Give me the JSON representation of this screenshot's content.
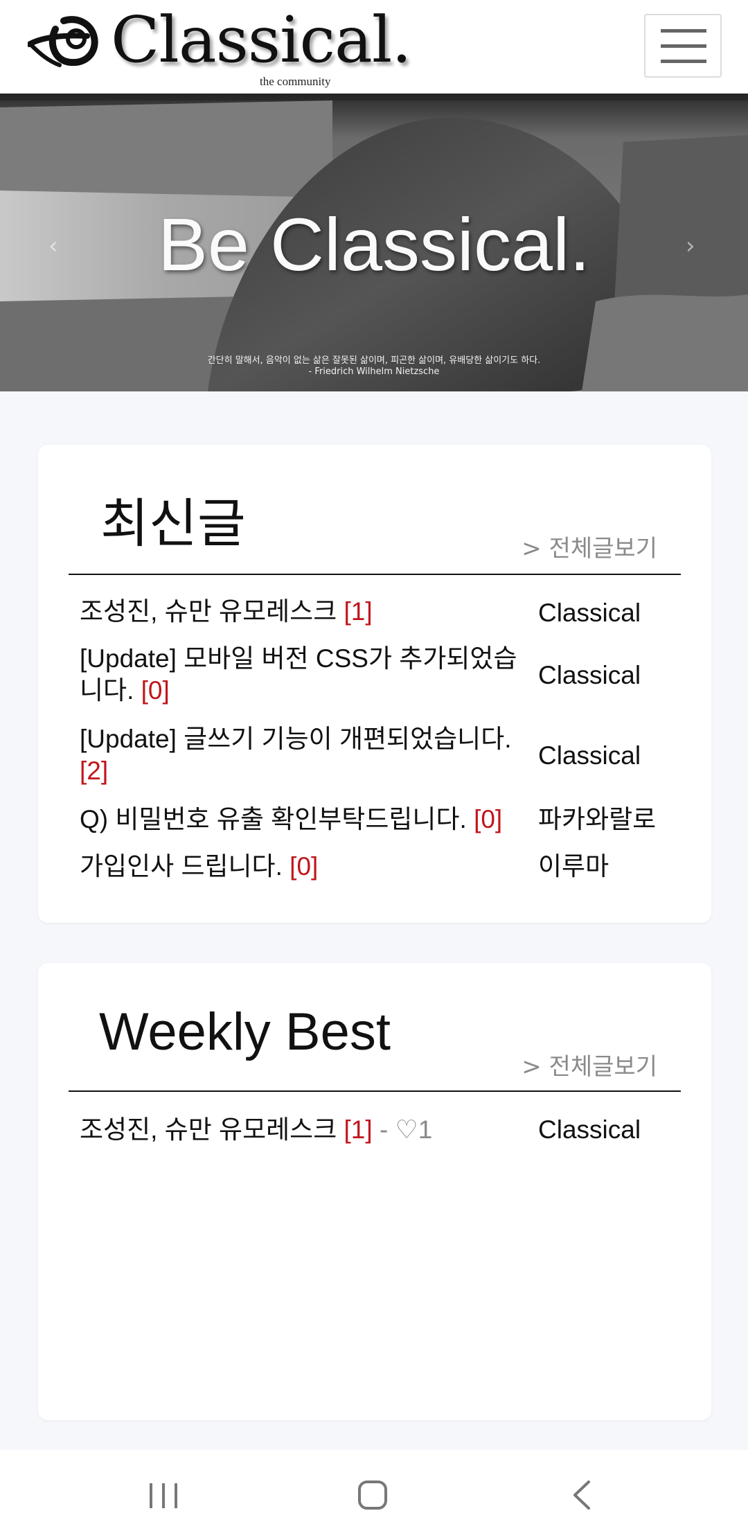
{
  "header": {
    "logo_text": "Classical.",
    "logo_sub": "the community",
    "menu_icon": "hamburger-icon"
  },
  "hero": {
    "title": "Be Classical.",
    "quote_line1": "간단히 말해서, 음악이 없는 삶은 잘못된 삶이며, 피곤한 삶이며, 유배당한 삶이기도 하다.",
    "quote_line2": "- Friedrich Wilhelm Nietzsche",
    "prev_icon": "chevron-left-icon",
    "next_icon": "chevron-right-icon"
  },
  "latest": {
    "title": "최신글",
    "view_all": "> 전체글보기",
    "posts": [
      {
        "title": "조성진, 슈만 유모레스크 ",
        "count": "[1]",
        "author": "Classical"
      },
      {
        "title": "[Update] 모바일 버전 CSS가 추가되었습니다. ",
        "count": "[0]",
        "author": "Classical"
      },
      {
        "title": "[Update] 글쓰기 기능이 개편되었습니다. ",
        "count": "[2]",
        "author": "Classical"
      },
      {
        "title": "Q) 비밀번호 유출 확인부탁드립니다. ",
        "count": "[0]",
        "author": "파카와랄로"
      },
      {
        "title": "가입인사 드립니다. ",
        "count": "[0]",
        "author": "이루마"
      }
    ]
  },
  "weekly": {
    "title": "Weekly Best",
    "view_all": "> 전체글보기",
    "posts": [
      {
        "title": "조성진, 슈만 유모레스크 ",
        "count": "[1]",
        "likes": " - ♡1",
        "author": "Classical"
      }
    ]
  },
  "system_nav": {
    "recents_icon": "recents-icon",
    "home_icon": "home-icon",
    "back_icon": "back-icon"
  },
  "colors": {
    "comment_count": "#c0161b",
    "page_background": "#f6f7fb",
    "muted": "#8a8a8a"
  }
}
